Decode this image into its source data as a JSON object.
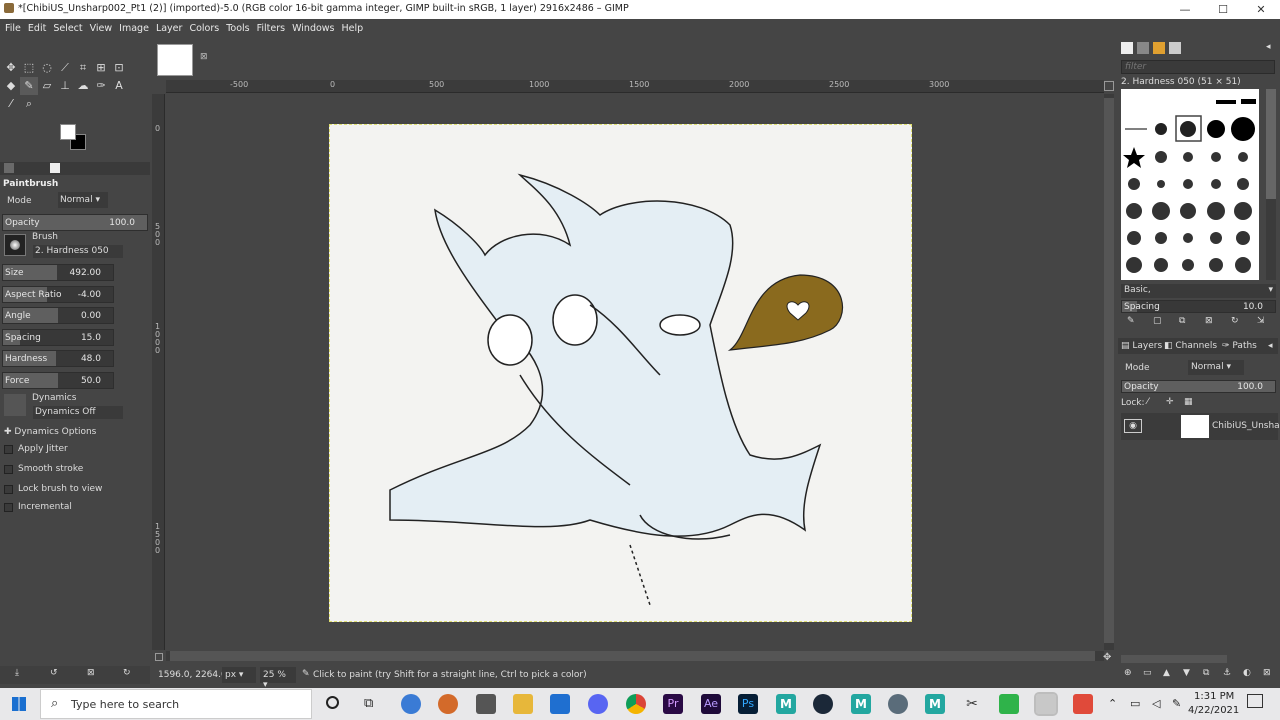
{
  "window": {
    "title": "*[ChibiUS_Unsharp002_Pt1 (2)] (imported)-5.0 (RGB color 16-bit gamma integer, GIMP built-in sRGB, 1 layer) 2916x2486 – GIMP",
    "min": "—",
    "max": "☐",
    "close": "✕"
  },
  "menu": [
    "File",
    "Edit",
    "Select",
    "View",
    "Image",
    "Layer",
    "Colors",
    "Tools",
    "Filters",
    "Windows",
    "Help"
  ],
  "tool_options": {
    "title": "Paintbrush",
    "mode_label": "Mode",
    "mode_value": "Normal",
    "opacity": {
      "label": "Opacity",
      "value": "100.0",
      "fraction": 1.0
    },
    "brush_label": "Brush",
    "brush_value": "2. Hardness 050",
    "size": {
      "label": "Size",
      "value": "492.00",
      "fraction": 0.49
    },
    "aspect": {
      "label": "Aspect Ratio",
      "value": "-4.00",
      "fraction": 0.4
    },
    "angle": {
      "label": "Angle",
      "value": "0.00",
      "fraction": 0.5
    },
    "spacing": {
      "label": "Spacing",
      "value": "15.0",
      "fraction": 0.15
    },
    "hardness": {
      "label": "Hardness",
      "value": "48.0",
      "fraction": 0.48
    },
    "force": {
      "label": "Force",
      "value": "50.0",
      "fraction": 0.5
    },
    "dynamics_label": "Dynamics",
    "dynamics_value": "Dynamics Off",
    "dynamics_options": "Dynamics Options",
    "apply_jitter": "Apply Jitter",
    "smooth_stroke": "Smooth stroke",
    "lock_brush": "Lock brush to view",
    "incremental": "Incremental"
  },
  "ruler_h": [
    "-500",
    "0",
    "500",
    "1000",
    "1500",
    "2000",
    "2500",
    "3000"
  ],
  "ruler_v": [
    "0",
    "5",
    "0",
    "0",
    "1",
    "0",
    "0",
    "0",
    "1",
    "5",
    "0",
    "0"
  ],
  "brushes": {
    "filter_placeholder": "filter",
    "selected": "2. Hardness 050 (51 × 51)",
    "tag": "Basic,",
    "spacing_label": "Spacing",
    "spacing_value": "10.0"
  },
  "layers": {
    "tabs": [
      "Layers",
      "Channels",
      "Paths"
    ],
    "mode_label": "Mode",
    "mode_value": "Normal",
    "opacity_label": "Opacity",
    "opacity_value": "100.0",
    "lock_label": "Lock:",
    "layer_name": "ChibiUS_Unsharp"
  },
  "status": {
    "coords": "1596.0, 2264.0",
    "unit": "px",
    "zoom": "25 %",
    "message": "Click to paint (try Shift for a straight line, Ctrl to pick a color)"
  },
  "taskbar": {
    "search_placeholder": "Type here to search",
    "time": "1:31 PM",
    "date": "4/22/2021"
  }
}
